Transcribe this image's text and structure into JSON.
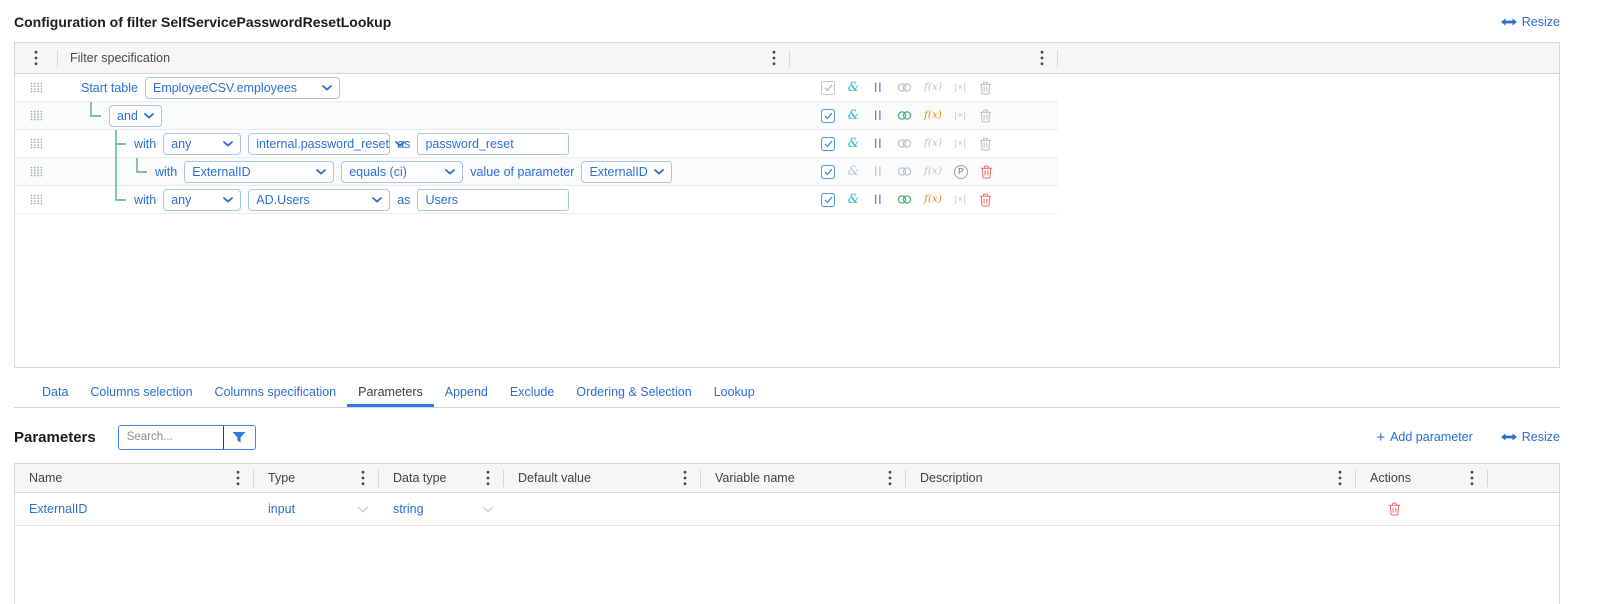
{
  "page": {
    "title": "Configuration of filter SelfServicePasswordResetLookup",
    "resize_label": "Resize"
  },
  "filter_panel": {
    "header_title": "Filter specification",
    "rows": [
      {
        "label": "Start table",
        "table_select": "EmployeeCSV.employees"
      },
      {
        "operator_select": "and"
      },
      {
        "with_label": "with",
        "quantifier_select": "any",
        "table_select": "internal.password_reset",
        "as_label": "as",
        "alias_value": "password_reset"
      },
      {
        "with_label": "with",
        "column_select": "ExternalID",
        "operator_select": "equals (ci)",
        "param_label": "value of parameter",
        "param_select": "ExternalID"
      },
      {
        "with_label": "with",
        "quantifier_select": "any",
        "table_select": "AD.Users",
        "as_label": "as",
        "alias_value": "Users"
      }
    ]
  },
  "icon_glyphs": {
    "and": "&",
    "or": "||",
    "fx": "f(x)",
    "exclude": "|×|",
    "param": "P"
  },
  "tabs": {
    "labels": [
      "Data",
      "Columns selection",
      "Columns specification",
      "Parameters",
      "Append",
      "Exclude",
      "Ordering & Selection",
      "Lookup"
    ],
    "active": "Parameters"
  },
  "parameters": {
    "heading": "Parameters",
    "search_placeholder": "Search...",
    "add_plus": "+",
    "add_label": "Add parameter",
    "resize_label": "Resize",
    "table": {
      "columns": [
        "Name",
        "Type",
        "Data type",
        "Default value",
        "Variable name",
        "Description",
        "Actions"
      ],
      "rows": [
        {
          "name": "ExternalID",
          "type": "input",
          "data_type": "string",
          "default_value": "",
          "variable_name": "",
          "description": ""
        }
      ]
    }
  }
}
